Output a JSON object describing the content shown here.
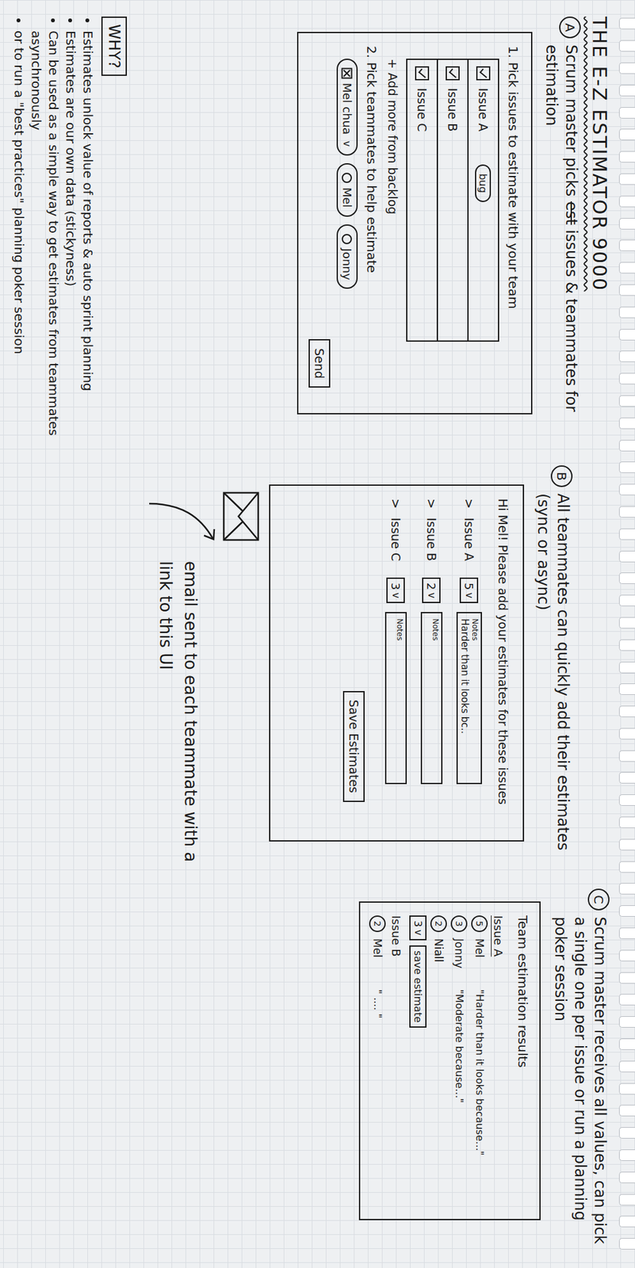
{
  "title": "THE E-Z ESTIMATOR 9000",
  "step_a": {
    "badge": "A",
    "caption_before": "Scrum master picks",
    "struck": "est",
    "caption_after": "issues & teammates for estimation",
    "issues_heading": "1. Pick issues to estimate with your team",
    "issues": [
      {
        "label": "Issue A",
        "checked": true,
        "tags": [
          "bug"
        ]
      },
      {
        "label": "Issue B",
        "checked": true,
        "tags": []
      },
      {
        "label": "Issue C",
        "checked": true,
        "tags": []
      }
    ],
    "add_more": "+ Add more from backlog",
    "teammates_heading": "2. Pick teammates to help estimate",
    "teammates": [
      {
        "label": "Mel chua",
        "selected": true,
        "caret": "v"
      },
      {
        "label": "Mel",
        "selected": false,
        "caret": ""
      },
      {
        "label": "Jonny",
        "selected": false,
        "caret": ""
      }
    ],
    "send": "Send"
  },
  "why": {
    "heading": "WHY?",
    "bullets": [
      "Estimates unlock value of reports & auto sprint planning",
      "Estimates are our own data (stickyness)",
      "Can be used as a simple way to get estimates from teammates asynchronously",
      "or to run a \"best practices\" planning poker session"
    ]
  },
  "step_b": {
    "badge": "B",
    "caption": "All teammates can quickly add their estimates (sync or async)",
    "greeting": "Hi Mel! Please add your estimates for these issues",
    "rows": [
      {
        "marker": ">",
        "label": "Issue A",
        "value": "5",
        "caret": "v",
        "notes_label": "Notes",
        "note": "Harder than it looks bc.."
      },
      {
        "marker": ">",
        "label": "Issue B",
        "value": "2",
        "caret": "v",
        "notes_label": "Notes",
        "note": ""
      },
      {
        "marker": ">",
        "label": "Issue C",
        "value": "3",
        "caret": "v",
        "notes_label": "Notes",
        "note": ""
      }
    ],
    "save": "Save Estimates",
    "email_note": "email sent to each teammate with a link to this UI"
  },
  "step_c": {
    "badge": "C",
    "caption": "Scrum master receives all values, can pick a single one per issue or run a planning poker session",
    "results_title": "Team estimation results",
    "issues": [
      {
        "label": "Issue A",
        "votes": [
          {
            "value": "5",
            "name": "Mel",
            "comment": "\"Harder than it looks because...\""
          },
          {
            "value": "3",
            "name": "Jonny",
            "comment": "\"Moderate because...\""
          },
          {
            "value": "2",
            "name": "Niall",
            "comment": ""
          }
        ],
        "pick": "3",
        "caret": "v",
        "save": "save estimate"
      },
      {
        "label": "Issue B",
        "votes": [
          {
            "value": "2",
            "name": "Mel",
            "comment": "\" .... \""
          }
        ],
        "pick": "",
        "caret": "",
        "save": ""
      }
    ]
  }
}
